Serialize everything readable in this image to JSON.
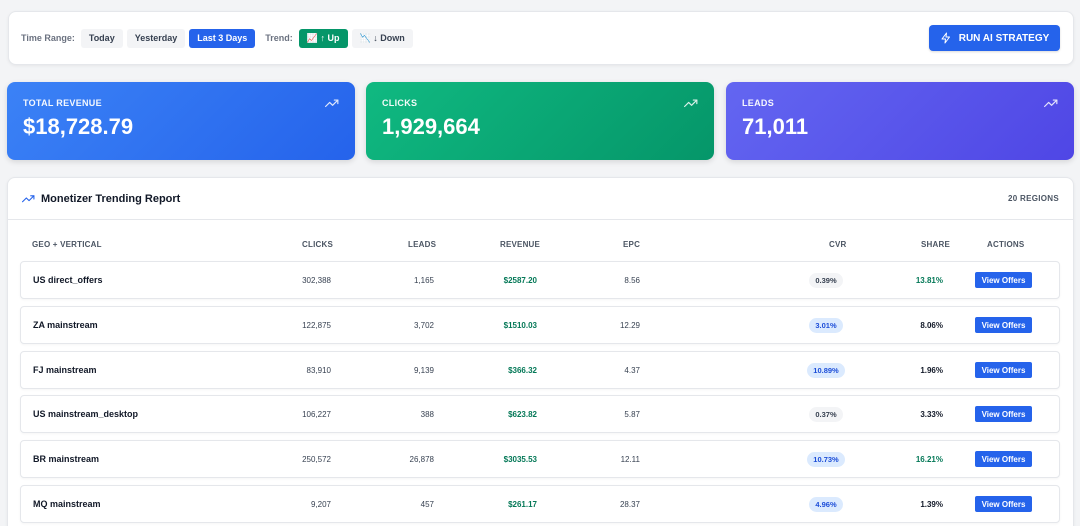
{
  "toolbar": {
    "time_range_label": "Time Range:",
    "time_options": [
      "Today",
      "Yesterday",
      "Last 3 Days"
    ],
    "trend_label": "Trend:",
    "trend_up": "📈 ↑ Up",
    "trend_down": "📉 ↓ Down",
    "ai_button": "RUN AI STRATEGY"
  },
  "kpis": [
    {
      "label": "TOTAL REVENUE",
      "value": "$18,728.79"
    },
    {
      "label": "CLICKS",
      "value": "1,929,664"
    },
    {
      "label": "LEADS",
      "value": "71,011"
    }
  ],
  "report": {
    "title": "Monetizer Trending Report",
    "count": "20 REGIONS",
    "columns": [
      "GEO + VERTICAL",
      "CLICKS",
      "LEADS",
      "REVENUE",
      "EPC",
      "CVR",
      "SHARE",
      "ACTIONS"
    ],
    "rows": [
      {
        "geo": "US direct_offers",
        "clicks": "302,388",
        "leads": "1,165",
        "revenue": "$2587.20",
        "epc": "8.56",
        "cvr": "0.39%",
        "share": "13.81%",
        "action": "View Offers"
      },
      {
        "geo": "ZA mainstream",
        "clicks": "122,875",
        "leads": "3,702",
        "revenue": "$1510.03",
        "epc": "12.29",
        "cvr": "3.01%",
        "share": "8.06%",
        "action": "View Offers"
      },
      {
        "geo": "FJ mainstream",
        "clicks": "83,910",
        "leads": "9,139",
        "revenue": "$366.32",
        "epc": "4.37",
        "cvr": "10.89%",
        "share": "1.96%",
        "action": "View Offers"
      },
      {
        "geo": "US mainstream_desktop",
        "clicks": "106,227",
        "leads": "388",
        "revenue": "$623.82",
        "epc": "5.87",
        "cvr": "0.37%",
        "share": "3.33%",
        "action": "View Offers"
      },
      {
        "geo": "BR mainstream",
        "clicks": "250,572",
        "leads": "26,878",
        "revenue": "$3035.53",
        "epc": "12.11",
        "cvr": "10.73%",
        "share": "16.21%",
        "action": "View Offers"
      },
      {
        "geo": "MQ mainstream",
        "clicks": "9,207",
        "leads": "457",
        "revenue": "$261.17",
        "epc": "28.37",
        "cvr": "4.96%",
        "share": "1.39%",
        "action": "View Offers"
      }
    ]
  },
  "colors": {
    "primary": "#2563eb",
    "success": "#059669",
    "indigo": "#4f46e5",
    "revenue_text": "#047857"
  }
}
